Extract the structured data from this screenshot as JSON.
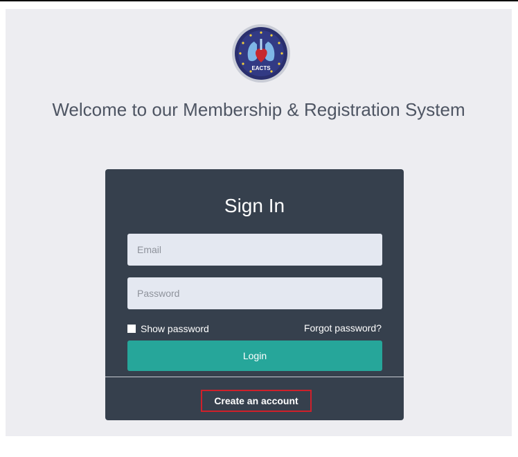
{
  "header": {
    "welcome_text": "Welcome to our Membership & Registration System",
    "logo_text": "EACTS"
  },
  "signin": {
    "title": "Sign In",
    "email_placeholder": "Email",
    "password_placeholder": "Password",
    "show_password_label": "Show password",
    "forgot_password_label": "Forgot password?",
    "login_label": "Login",
    "create_account_label": "Create an account"
  },
  "colors": {
    "page_background": "#ededf1",
    "card_background": "#36404d",
    "login_button": "#26a69a",
    "input_background": "#e4e8f1",
    "highlight_border": "#d0202a"
  },
  "icons": {
    "logo": "eacts-heart-lungs-logo"
  }
}
